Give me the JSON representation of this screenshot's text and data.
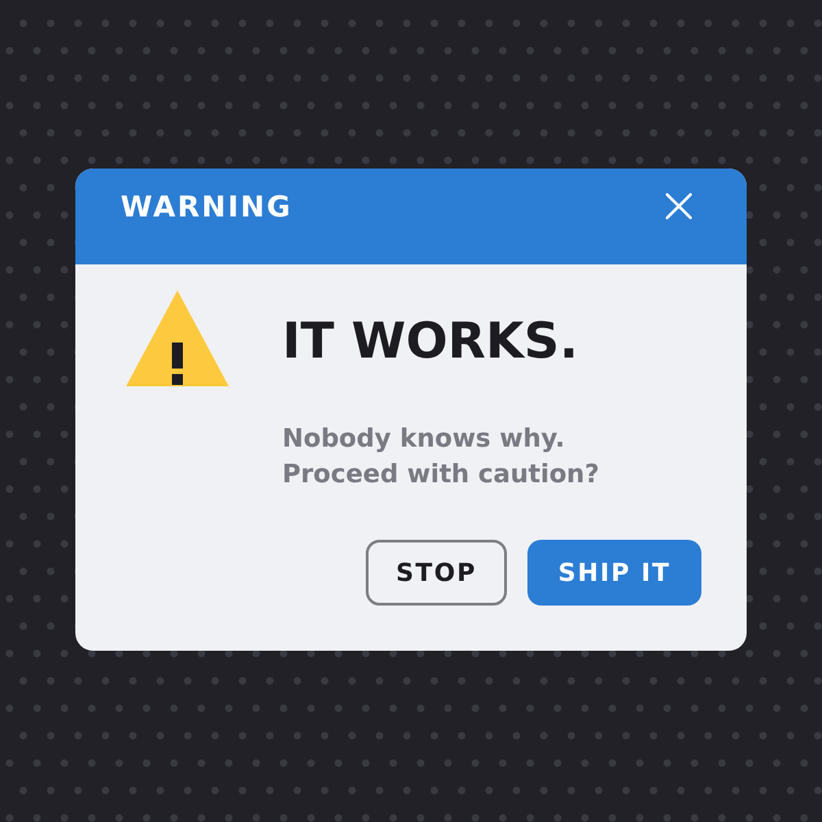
{
  "dialog": {
    "title": "WARNING",
    "heading": "IT WORKS.",
    "message": "Nobody knows why.\nProceed with caution?",
    "buttons": [
      {
        "label": "STOP",
        "kind": "secondary"
      },
      {
        "label": "SHIP IT",
        "kind": "primary"
      }
    ]
  }
}
